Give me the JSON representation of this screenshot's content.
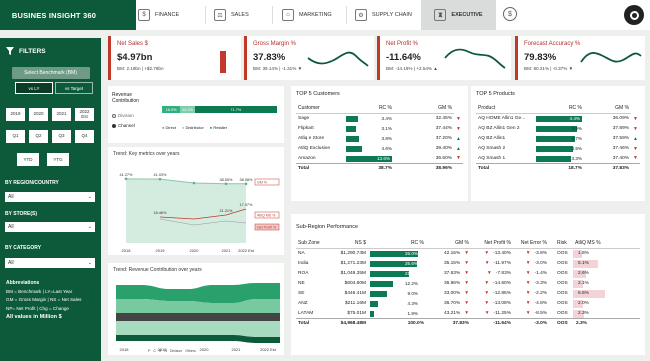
{
  "app": {
    "title": "BUSINES INSIGHT 360"
  },
  "nav": {
    "tabs": [
      {
        "label": "FINANCE",
        "icon": "finance-icon"
      },
      {
        "label": "SALES",
        "icon": "sales-icon"
      },
      {
        "label": "MARKETING",
        "icon": "marketing-icon"
      },
      {
        "label": "SUPPLY CHAIN",
        "icon": "supply-chain-icon"
      },
      {
        "label": "EXECUTIVE",
        "icon": "executive-icon",
        "active": true
      }
    ]
  },
  "sidebar": {
    "filters_title": "FILTERS",
    "benchmark_label": "Select Benchmark (BM)",
    "benchmark_options": [
      "vs LY",
      "vs Target"
    ],
    "years": [
      "2019",
      "2020",
      "2021",
      "2022 Est"
    ],
    "quarters": [
      "Q1",
      "Q2",
      "Q3",
      "Q4"
    ],
    "period_toggles": [
      "YTD",
      "YTG"
    ],
    "region_label": "BY REGION/COUNTRY",
    "region_value": "All",
    "stores_label": "BY STORE(S)",
    "stores_value": "All",
    "category_label": "BY CATEGORY",
    "category_value": "All",
    "abbr_title": "Abbreviations",
    "abbr_lines": [
      "BM = Benchmark | LY=Last Year",
      "GM = Gross Margin | NS = Net Sales",
      "NP= Net Profit | Chg = Change"
    ],
    "all_values_note": "All values in Million $"
  },
  "kpis": [
    {
      "title": "Net Sales $",
      "value": "$4.97bn",
      "sub": "BM: 2.19bn | +$2.78bn",
      "trend": "up",
      "accent": "#c0392b"
    },
    {
      "title": "Gross Margin %",
      "value": "37.83%",
      "sub": "BM: 39.14% | -1.31% ▼",
      "trend": "down",
      "accent": "#c0392b"
    },
    {
      "title": "Net Profit %",
      "value": "-11.64%",
      "sub": "BM: -14.18% | +2.54% ▲",
      "trend": "up",
      "accent": "#c0392b"
    },
    {
      "title": "Forecast Accuracy %",
      "value": "79.83%",
      "sub": "BM: 80.21% | -0.37% ▼",
      "trend": "down",
      "accent": "#c0392b"
    }
  ],
  "revenue_contribution": {
    "title": "Revenue Contribution",
    "legend_divisions": [
      "Division",
      "Channel"
    ],
    "bar_labels": [
      "16.0%",
      "12.2%",
      "71.7%"
    ],
    "bar_values": [
      16.0,
      12.2,
      71.7
    ],
    "legend": [
      "Direct",
      "Distributor",
      "Retailer"
    ]
  },
  "trend_kpi": {
    "title": "Trend: Key metrics over years",
    "chart_data": {
      "type": "line",
      "x": [
        "2018",
        "2019",
        "2020",
        "2021",
        "2022 Est"
      ],
      "series": [
        {
          "name": "GM %",
          "values": [
            41.27,
            41.03,
            38.55,
            38.08,
            38.08
          ]
        },
        {
          "name": "AtliQ MS %",
          "values": [
            null,
            18.46,
            17.97,
            21.21,
            27.07
          ]
        },
        {
          "name": "Net Profit %",
          "values": [
            null,
            null,
            null,
            null,
            0
          ]
        }
      ],
      "point_labels": {
        "GM %": [
          "41.27%",
          "41.03%",
          "",
          "38.55%",
          "38.08%"
        ],
        "AtliQ MS %": [
          "",
          "18.46%",
          "",
          "21.21%",
          "17.97%"
        ]
      }
    },
    "tags": [
      "GM %",
      "AtliQ MS %",
      "Net Profit %"
    ]
  },
  "trend_revenue": {
    "title": "Trend: Revenue Contribution over years",
    "x": [
      "2018",
      "2019",
      "2020",
      "2021",
      "2022 Est"
    ],
    "legend": [
      "P",
      "C",
      "R",
      "N",
      "Division",
      "Others"
    ]
  },
  "top_customers": {
    "title": "TOP 5 Customers",
    "columns": [
      "Customer",
      "RC %",
      "GM %"
    ],
    "rows": [
      {
        "name": "Sage",
        "rc": "3.4%",
        "rc_val": 3.4,
        "gm": "32.45%",
        "ind": "down"
      },
      {
        "name": "Flipkart",
        "rc": "3.1%",
        "rc_val": 3.1,
        "gm": "37.44%",
        "ind": "down"
      },
      {
        "name": "Atliq e Store",
        "rc": "3.8%",
        "rc_val": 3.8,
        "gm": "37.20%",
        "ind": "up"
      },
      {
        "name": "AtliQ Exclusive",
        "rc": "4.6%",
        "rc_val": 4.6,
        "gm": "39.40%",
        "ind": "up"
      },
      {
        "name": "Amazon",
        "rc": "13.6%",
        "rc_val": 13.6,
        "gm": "36.60%",
        "ind": "down"
      }
    ],
    "total": {
      "name": "Total",
      "rc": "38.7%",
      "gm": "38.96%"
    }
  },
  "top_products": {
    "title": "TOP 5 Products",
    "columns": [
      "Product",
      "RC %",
      "GM %"
    ],
    "rows": [
      {
        "name": "AQ HOME Allin1 Ge...",
        "rc": "4.4%",
        "rc_val": 4.4,
        "gm": "36.09%",
        "ind": "down"
      },
      {
        "name": "AQ BZ Allin1 Gen 2",
        "rc": "3.9%",
        "rc_val": 3.9,
        "gm": "37.89%",
        "ind": "down"
      },
      {
        "name": "AQ BZ Allin1",
        "rc": "3.7%",
        "rc_val": 3.7,
        "gm": "37.59%",
        "ind": "up"
      },
      {
        "name": "AQ Smash 2",
        "rc": "3.5%",
        "rc_val": 3.5,
        "gm": "37.46%",
        "ind": "down"
      },
      {
        "name": "AQ Smash 1",
        "rc": "3.3%",
        "rc_val": 3.3,
        "gm": "37.40%",
        "ind": "down"
      }
    ],
    "total": {
      "name": "Total",
      "rc": "18.7%",
      "gm": "37.83%"
    }
  },
  "subregion": {
    "title": "Sub-Region Performance",
    "columns": [
      "Sub Zone",
      "NS $",
      "RC %",
      "GM %",
      "Net Profit %",
      "Net Error %",
      "Risk",
      "AtliQ MS %"
    ],
    "rows": [
      {
        "zone": "NA",
        "ns": "$1,290.74M",
        "rc": "26.0%",
        "rc_val": 26.0,
        "gm": "42.15%",
        "np": "-13.40%",
        "ne": "-3.8%",
        "risk": "OOS",
        "ms": "1.8%",
        "ms_val": 1.8
      },
      {
        "zone": "India",
        "ns": "$1,271.23M",
        "rc": "25.6%",
        "rc_val": 25.6,
        "gm": "35.15%",
        "np": "-11.97%",
        "ne": "-3.0%",
        "risk": "OOS",
        "ms": "5.1%",
        "ms_val": 5.1
      },
      {
        "zone": "ROA",
        "ns": "$1,049.35M",
        "rc": "21.1%",
        "rc_val": 21.1,
        "gm": "37.63%",
        "np": "-7.83%",
        "ne": "-1.4%",
        "risk": "OOS",
        "ms": "2.6%",
        "ms_val": 2.6
      },
      {
        "zone": "NE",
        "ns": "$604.60M",
        "rc": "12.2%",
        "rc_val": 12.2,
        "gm": "36.96%",
        "np": "-14.60%",
        "ne": "-3.3%",
        "risk": "OOS",
        "ms": "2.1%",
        "ms_val": 2.1
      },
      {
        "zone": "SE",
        "ns": "$446.41M",
        "rc": "9.0%",
        "rc_val": 9.0,
        "gm": "33.00%",
        "np": "-12.85%",
        "ne": "-2.2%",
        "risk": "OOS",
        "ms": "6.6%",
        "ms_val": 6.6
      },
      {
        "zone": "ANZ",
        "ns": "$211.16M",
        "rc": "4.3%",
        "rc_val": 4.3,
        "gm": "36.70%",
        "np": "-13.08%",
        "ne": "-4.8%",
        "risk": "OOS",
        "ms": "2.0%",
        "ms_val": 2.0
      },
      {
        "zone": "LATAM",
        "ns": "$75.01M",
        "rc": "1.9%",
        "rc_val": 1.9,
        "gm": "43.21%",
        "np": "-11.25%",
        "ne": "-8.5%",
        "risk": "OOS",
        "ms": "2.3%",
        "ms_val": 2.3
      }
    ],
    "total": {
      "zone": "Total",
      "ns": "$4,968.48M",
      "rc": "100.0%",
      "gm": "37.83%",
      "np": "-11.64%",
      "ne": "-3.0%",
      "risk": "OOS",
      "ms": "2.3%"
    }
  },
  "colors": {
    "brand": "#0d5a3a",
    "accent_red": "#c0392b",
    "bar_green": "#0e7a55",
    "ms_pink": "#f2d3d8"
  }
}
